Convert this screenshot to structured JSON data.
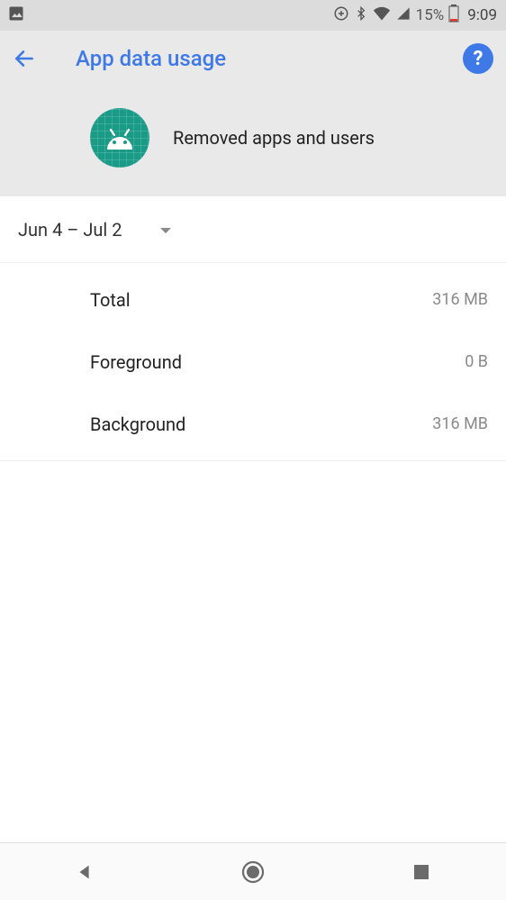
{
  "status": {
    "battery_percent": "15%",
    "time": "9:09"
  },
  "header": {
    "title": "App data usage",
    "help_label": "?"
  },
  "app": {
    "name": "Removed apps and users"
  },
  "date_range": "Jun 4 – Jul 2",
  "stats": {
    "total_label": "Total",
    "total_value": "316 MB",
    "foreground_label": "Foreground",
    "foreground_value": "0 B",
    "background_label": "Background",
    "background_value": "316 MB"
  }
}
